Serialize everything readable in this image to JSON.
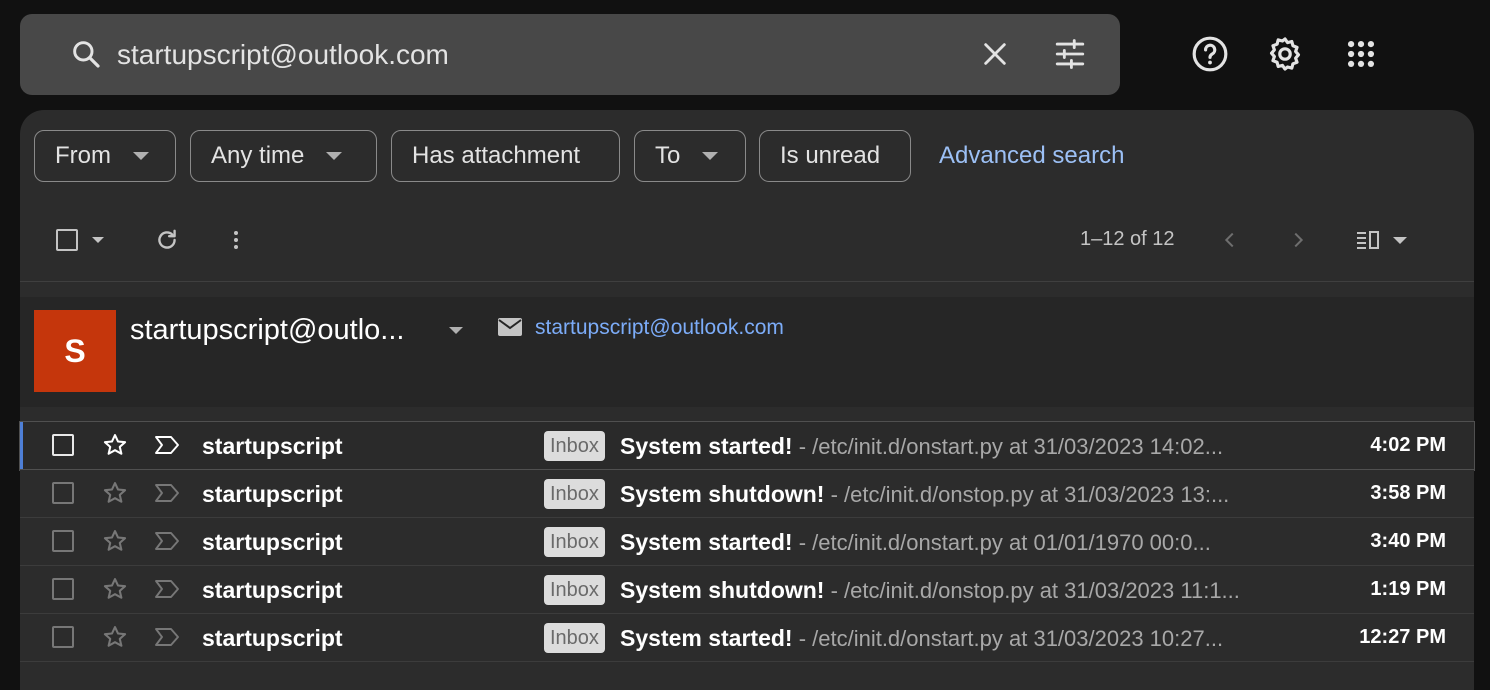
{
  "search": {
    "query": "startupscript@outlook.com"
  },
  "filters": {
    "chips": [
      "From",
      "Any time",
      "Has attachment",
      "To",
      "Is unread"
    ],
    "advanced_label": "Advanced search"
  },
  "toolbar": {
    "pagination": "1–12 of 12"
  },
  "contact": {
    "avatar_letter": "S",
    "name": "startupscript@outlo...",
    "email": "startupscript@outlook.com",
    "avatar_color": "#c5360c"
  },
  "emails": [
    {
      "sender": "startupscript",
      "label": "Inbox",
      "subject": "System started!",
      "snippet": " - /etc/init.d/onstart.py at 31/03/2023 14:02...",
      "time": "4:02 PM"
    },
    {
      "sender": "startupscript",
      "label": "Inbox",
      "subject": "System shutdown!",
      "snippet": " - /etc/init.d/onstop.py at 31/03/2023 13:...",
      "time": "3:58 PM"
    },
    {
      "sender": "startupscript",
      "label": "Inbox",
      "subject": "System started!",
      "snippet": " - /etc/init.d/onstart.py at 01/01/1970 00:0...",
      "time": "3:40 PM"
    },
    {
      "sender": "startupscript",
      "label": "Inbox",
      "subject": "System shutdown!",
      "snippet": " - /etc/init.d/onstop.py at 31/03/2023 11:1...",
      "time": "1:19 PM"
    },
    {
      "sender": "startupscript",
      "label": "Inbox",
      "subject": "System started!",
      "snippet": " - /etc/init.d/onstart.py at 31/03/2023 10:27...",
      "time": "12:27 PM"
    }
  ],
  "icons": {
    "search": "search-icon",
    "clear": "close-icon",
    "tune": "tune-icon",
    "help": "help-icon",
    "settings": "gear-icon",
    "apps": "apps-grid-icon",
    "refresh": "refresh-icon",
    "more": "more-vert-icon",
    "prev": "chevron-left-icon",
    "next": "chevron-right-icon",
    "split": "split-pane-icon",
    "mail": "mail-icon",
    "star": "star-icon",
    "important": "important-marker-icon"
  },
  "colors": {
    "accent_link": "#9cc0f5",
    "selected_bar": "#4e7fd6"
  }
}
